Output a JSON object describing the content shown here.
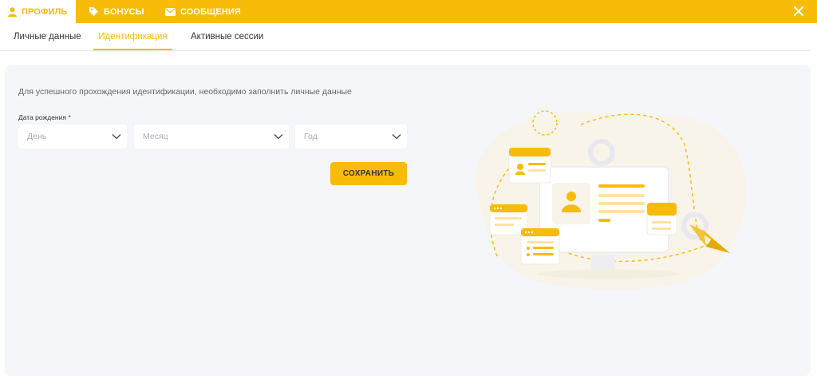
{
  "header": {
    "tabs": [
      {
        "label": "Профиль",
        "icon": "person-icon"
      },
      {
        "label": "Бонусы",
        "icon": "tag-icon"
      },
      {
        "label": "Сообщения",
        "icon": "envelope-icon"
      }
    ],
    "close_icon": "close-icon"
  },
  "subnav": {
    "tabs": [
      {
        "label": "Личные данные"
      },
      {
        "label": "Идентификация"
      },
      {
        "label": "Активные сессии"
      }
    ]
  },
  "form": {
    "intro": "Для успешного прохождения идентификации, необходимо заполнить личные данные",
    "dob_label": "Дата рождения *",
    "day": "День",
    "month": "Месяц",
    "year": "Год",
    "save": "Сохранить"
  },
  "colors": {
    "accent": "#f8bb07",
    "panel": "#f5f6fa",
    "text": "#333333",
    "muted": "#a9abb3"
  }
}
